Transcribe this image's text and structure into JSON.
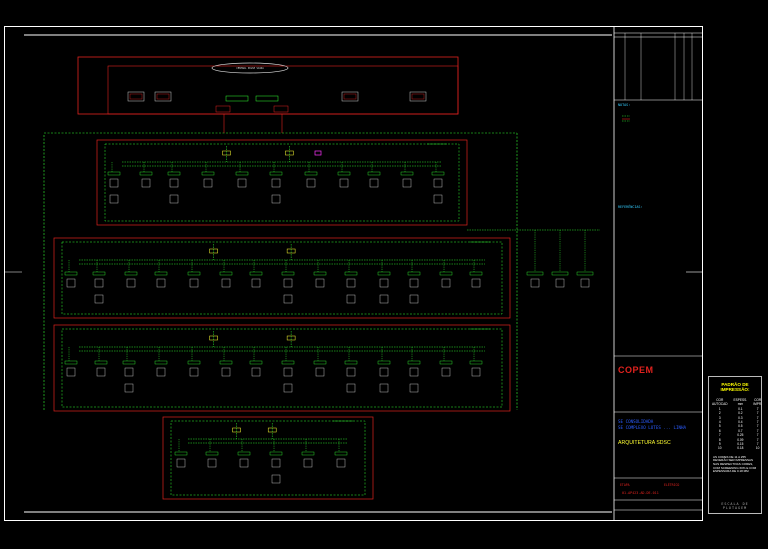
{
  "colors": {
    "frame": "#ffffff",
    "red": "#e0221e",
    "green": "#33ff33",
    "yellow": "#ffff33",
    "blue": "#2a5cff",
    "magenta": "#ff33ff",
    "brand": "#e0221e"
  },
  "title_block": {
    "brand": "COPEM",
    "project_line1": "SE CONSOLIDADA",
    "project_line2": "SE COMPLEXO LOTES ... LINHA",
    "architecture": "ARQUITETURA SDSC",
    "sheet_label_left": "ETAPA",
    "sheet_label_right": "ELÉTRICO",
    "drawing_no": "01-AP423-AD-DE-011"
  },
  "notes_title": "NOTAS:",
  "refs_title": "REFERÊNCIAS:",
  "cloud_label": "CENTRAL PULSE SCADA",
  "print_table": {
    "title": "PADRÃO DE IMPRESSÃO:",
    "headers": [
      "COR AUTOCAD",
      "ESPESS. mm",
      "COR IMPR."
    ],
    "rows": [
      [
        "1",
        "0.1",
        "7"
      ],
      [
        "2",
        "0.2",
        "7"
      ],
      [
        "3",
        "0.3",
        "7"
      ],
      [
        "4",
        "0.4",
        "7"
      ],
      [
        "5",
        "0.5",
        "7"
      ],
      [
        "6",
        "0.7",
        "7"
      ],
      [
        "7",
        "0.25",
        "7"
      ],
      [
        "8",
        "0.09",
        "7"
      ],
      [
        "9",
        "0.15",
        "7"
      ],
      [
        "10",
        "0.18",
        "10"
      ]
    ],
    "note": "AS CORES DE 11 A 255 DEVERÃO SER IMPRESSAS NAS RESPECTIVAS CORES, COM SCREENING 60% E COM ESPESSURA DE 0.18 MM",
    "plot_label": "ESCALA DE PLOTAGEM"
  }
}
